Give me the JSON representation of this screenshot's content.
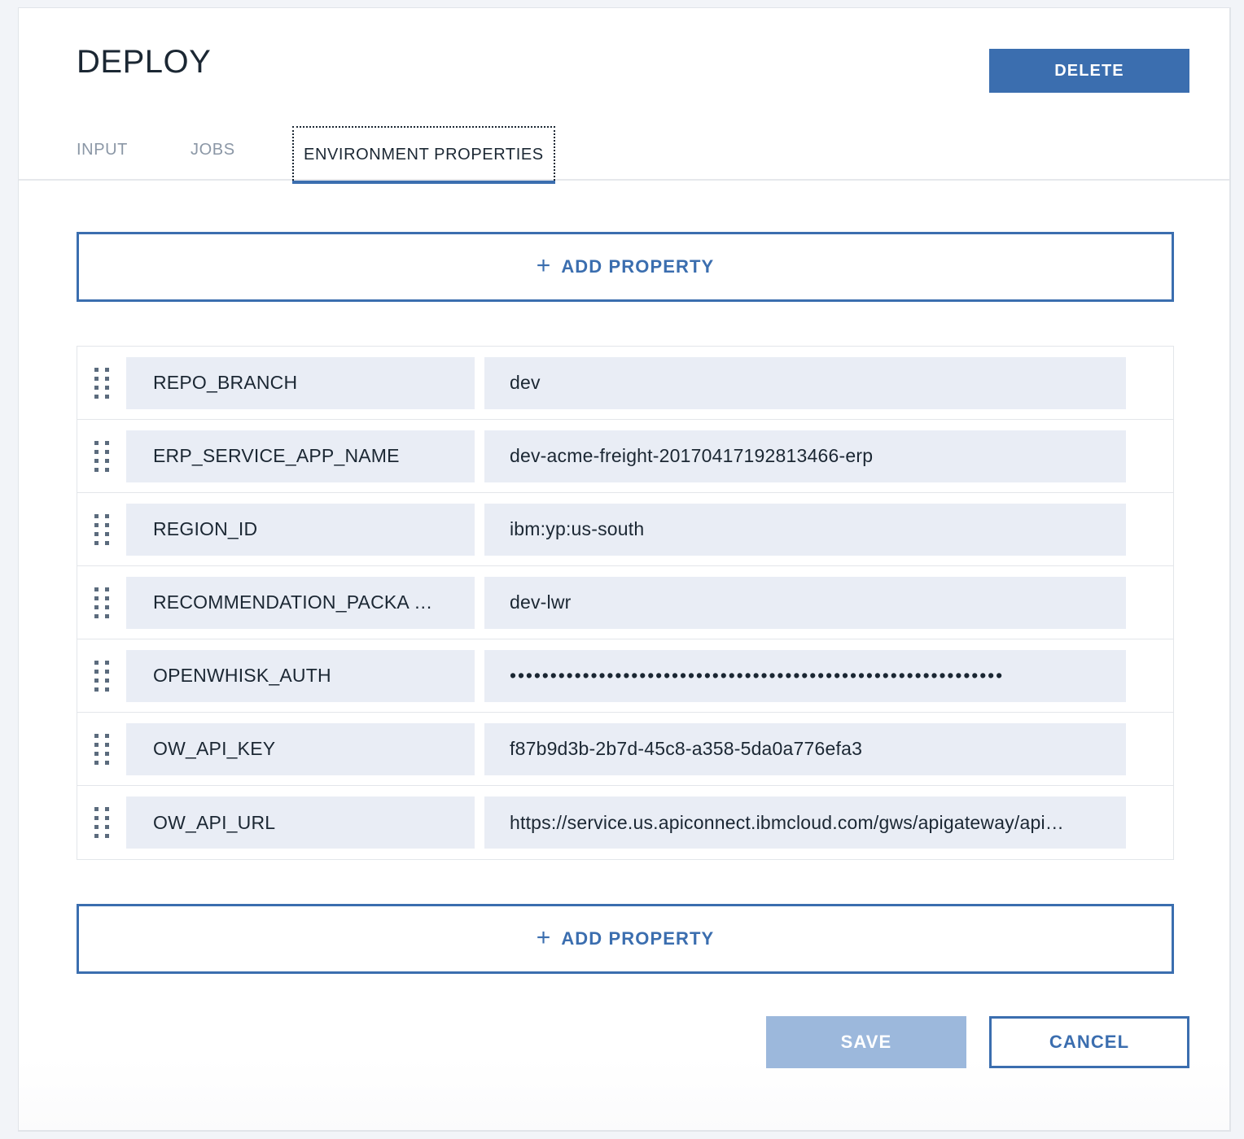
{
  "header": {
    "title": "DEPLOY",
    "delete_label": "DELETE"
  },
  "tabs": [
    {
      "label": "INPUT",
      "active": false
    },
    {
      "label": "JOBS",
      "active": false
    },
    {
      "label": "ENVIRONMENT PROPERTIES",
      "active": true
    }
  ],
  "add_property": {
    "label": "ADD PROPERTY",
    "plus": "+"
  },
  "properties": [
    {
      "name": "REPO_BRANCH",
      "value": "dev",
      "masked": false
    },
    {
      "name": "ERP_SERVICE_APP_NAME",
      "value": "dev-acme-freight-20170417192813466-erp",
      "masked": false
    },
    {
      "name": "REGION_ID",
      "value": "ibm:yp:us-south",
      "masked": false
    },
    {
      "name": "RECOMMENDATION_PACKA  …",
      "value": "dev-lwr",
      "masked": false
    },
    {
      "name": "OPENWHISK_AUTH",
      "value": "•••••••••••••••••••••••••••••••••••••••••••••••••••••••••••••",
      "masked": true
    },
    {
      "name": "OW_API_KEY",
      "value": "f87b9d3b-2b7d-45c8-a358-5da0a776efa3",
      "masked": false
    },
    {
      "name": "OW_API_URL",
      "value": "https://service.us.apiconnect.ibmcloud.com/gws/apigateway/api…",
      "masked": false
    }
  ],
  "footer": {
    "save_label": "SAVE",
    "cancel_label": "CANCEL"
  },
  "colors": {
    "accent_blue": "#3b6eaf",
    "save_disabled": "#9cb8dc",
    "field_bg": "#e9edf5",
    "page_bg": "#f2f4f8",
    "text_dark": "#1b2733",
    "tab_inactive": "#8b97a6"
  }
}
